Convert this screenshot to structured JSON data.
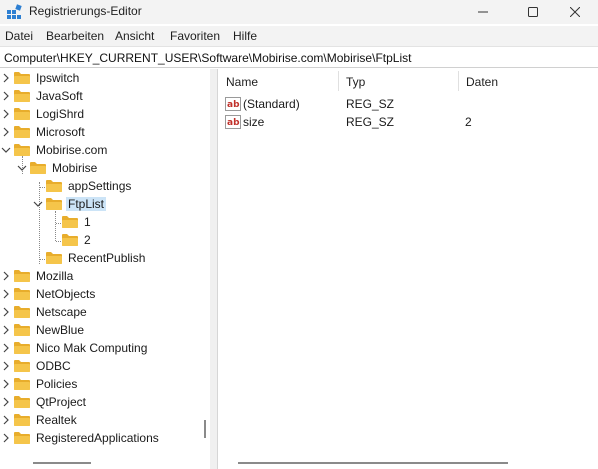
{
  "window": {
    "title": "Registrierungs-Editor",
    "app_icon": "registry-editor-icon",
    "controls": [
      "minimize-icon",
      "maximize-icon",
      "close-icon"
    ]
  },
  "menu": [
    "Datei",
    "Bearbeiten",
    "Ansicht",
    "Favoriten",
    "Hilfe"
  ],
  "address": "Computer\\HKEY_CURRENT_USER\\Software\\Mobirise.com\\Mobirise\\FtpList",
  "tree": {
    "items": [
      {
        "label": "Ipswitch",
        "expander": "collapsed"
      },
      {
        "label": "JavaSoft",
        "expander": "collapsed"
      },
      {
        "label": "LogiShrd",
        "expander": "collapsed"
      },
      {
        "label": "Microsoft",
        "expander": "collapsed"
      },
      {
        "label": "Mobirise.com",
        "expander": "expanded"
      },
      {
        "label": "Mobirise",
        "expander": "expanded"
      },
      {
        "label": "appSettings",
        "expander": "none"
      },
      {
        "label": "FtpList",
        "expander": "expanded",
        "selected": true
      },
      {
        "label": "1",
        "expander": "none"
      },
      {
        "label": "2",
        "expander": "none"
      },
      {
        "label": "RecentPublish",
        "expander": "none"
      },
      {
        "label": "Mozilla",
        "expander": "collapsed"
      },
      {
        "label": "NetObjects",
        "expander": "collapsed"
      },
      {
        "label": "Netscape",
        "expander": "collapsed"
      },
      {
        "label": "NewBlue",
        "expander": "collapsed"
      },
      {
        "label": "Nico Mak Computing",
        "expander": "collapsed"
      },
      {
        "label": "ODBC",
        "expander": "collapsed"
      },
      {
        "label": "Policies",
        "expander": "collapsed"
      },
      {
        "label": "QtProject",
        "expander": "collapsed"
      },
      {
        "label": "Realtek",
        "expander": "collapsed"
      },
      {
        "label": "RegisteredApplications",
        "expander": "collapsed"
      }
    ]
  },
  "values": {
    "columns": [
      "Name",
      "Typ",
      "Daten"
    ],
    "rows": [
      {
        "icon": "string-value-icon",
        "name": "(Standard)",
        "type": "REG_SZ",
        "data": ""
      },
      {
        "icon": "string-value-icon",
        "name": "size",
        "type": "REG_SZ",
        "data": "2"
      }
    ]
  },
  "colors": {
    "folder": "#f5c54a",
    "selection": "#cce4f7",
    "string_icon": "#c1302a"
  }
}
